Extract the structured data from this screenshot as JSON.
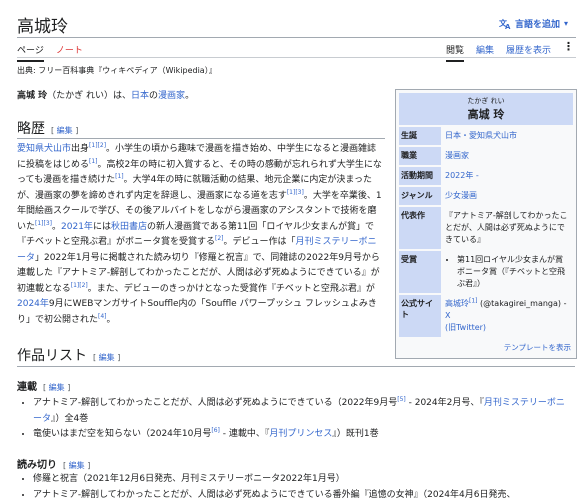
{
  "header": {
    "title": "高城玲",
    "lang_button": "言語を追加"
  },
  "tabs": {
    "page": "ページ",
    "talk": "ノート",
    "read": "閲覧",
    "edit": "編集",
    "history": "履歴を表示"
  },
  "from_line": "出典: フリー百科事典『ウィキペディア（Wikipedia）』",
  "lead": {
    "name": "高城 玲",
    "reading": "（たかぎ れい）は、",
    "country": "日本",
    "no": "の",
    "job": "漫画家",
    "end": "。"
  },
  "edit_label": "編集",
  "career": {
    "heading": "略歴",
    "p1": "愛知県犬山市",
    "p1b": "出身",
    "p1c": "。小学生の頃から趣味で漫画を描き始め、中学生になると漫画雑誌に投稿をはじめる",
    "p1d": "。高校2年の時に初入賞すると、その時の感動が忘れられず大学生になっても漫画を描き続けた",
    "p1e": "。大学4年の時に就職活動の結果、地元企業に内定が決まったが、漫画家の夢を諦めきれず内定を辞退し、漫画家になる道を志す",
    "p1f": "。大学を卒業後、1年間絵画スクールで学び、その後アルバイトをしながら漫画家のアシスタントで技術を磨いた",
    "p1g": "。",
    "year2021": "2021年",
    "p1h": "には",
    "publisher": "秋田書店",
    "p1i": "の新人漫画賞である第11回「ロイヤル少女まんが賞」で『チベットと空飛ぶ君』がボニータ賞を受賞する",
    "p1j": "。デビュー作は「",
    "magazine": "月刊ミステリーボニータ",
    "p1k": "」2022年1月号に掲載された読み切り『修羅と祝言』で、同雑誌の2022年9月号から連載した『アナトミア-解剖してわかったことだが、人間は必ず死ぬようにできている』が初連載となる",
    "p1l": "。また、デビューのきっかけとなった受賞作『チベットと空飛ぶ君』が",
    "date2024": "2024年",
    "p1m": "9月にWEBマンガサイトSouffle内の「Souffle パワープッシュ フレッシュよみきり」で初公開された",
    "p1n": "。",
    "refs": [
      "[1]",
      "[2]",
      "[1]",
      "[1]",
      "[1]",
      "[3]",
      "[1]",
      "[3]",
      "[2]",
      "[1]",
      "[2]",
      "[4]"
    ]
  },
  "infobox": {
    "ruby": "たかぎ れい",
    "name": "高城 玲",
    "rows": [
      {
        "key": "生誕",
        "val": "日本・愛知県犬山市"
      },
      {
        "key": "職業",
        "val": "漫画家"
      },
      {
        "key": "活動期間",
        "val": "2022年 -"
      },
      {
        "key": "ジャンル",
        "val": "少女漫画"
      },
      {
        "key": "代表作",
        "val": "『アナトミア-解剖してわかったことだが、人間は必ず死ぬようにできている』"
      },
      {
        "key": "受賞",
        "val": "第11回ロイヤル少女まんが賞ボニータ賞（『チベットと空飛ぶ君』）"
      },
      {
        "key": "公式サイト",
        "val_link": "高城玲",
        "val_sup": "[1]",
        "val_mid": " (@takagirei_manga) - ",
        "val_x": "X",
        "val_tail": "(旧Twitter)"
      }
    ],
    "template": "テンプレートを表示"
  },
  "works": {
    "heading": "作品リスト",
    "serial_heading": "連載",
    "serial": [
      {
        "text_a": "アナトミア-解剖してわかったことだが、人間は必ず死ぬようにできている（2022年9月号",
        "sup": "[5]",
        "text_b": " - 2024年2月号、『",
        "link": "月刊ミステリーボニータ",
        "text_c": "』）全4巻"
      },
      {
        "text_a": "竜使いはまだ空を知らない（2024年10月号",
        "sup": "[6]",
        "text_b": " - 連載中、『",
        "link": "月刊プリンセス",
        "text_c": "』）既刊1巻"
      }
    ],
    "oneshot_heading": "読み切り",
    "oneshot": [
      {
        "text": "修羅と祝言（2021年12月6日発売、月刊ミステリーボニータ2022年1月号）"
      },
      {
        "text": "アナトミア-解剖してわかったことだが、人間は必ず死ぬようにできている番外編『追憶の女神』（2024年4月6日発売、"
      }
    ]
  }
}
